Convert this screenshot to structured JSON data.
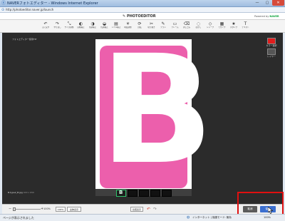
{
  "window": {
    "title": "NAVERフォトエディター - Windows Internet Explorer",
    "address": "http://photoeditor.naver.jp/launch",
    "min_icon": "minimize-icon",
    "max_icon": "maximize-icon",
    "close_icon": "close-icon"
  },
  "app": {
    "logo": "PHOTOEDITOR",
    "powered_by": "Powered by",
    "brand": "NAVER"
  },
  "toolbar": {
    "tools": [
      {
        "label": "元に戻す",
        "icon": "↶"
      },
      {
        "label": "やり直し",
        "icon": "↷"
      },
      {
        "label": "サイズ調整",
        "icon": "⤡"
      },
      {
        "label": "自動補正",
        "icon": "◐"
      },
      {
        "label": "色調補正",
        "icon": "◑"
      },
      {
        "label": "色調補正",
        "icon": "◒"
      },
      {
        "label": "レベル補正",
        "icon": "▤"
      },
      {
        "label": "明度調整",
        "icon": "☀"
      },
      {
        "label": "回転",
        "icon": "⟳"
      },
      {
        "label": "切り抜き",
        "icon": "✂"
      },
      {
        "label": "ブラシ",
        "icon": "✎"
      },
      {
        "label": "フレーム",
        "icon": "▭"
      },
      {
        "label": "消しゴム",
        "icon": "⌫"
      },
      {
        "label": "ぼかし",
        "icon": "◌"
      },
      {
        "label": "シャープ",
        "icon": "◇"
      },
      {
        "label": "モザイク",
        "icon": "▦"
      },
      {
        "label": "スタンプ",
        "icon": "★"
      },
      {
        "label": "テキスト",
        "icon": "T"
      }
    ]
  },
  "editor": {
    "breadcrumb": "フォトエディター使用TIP",
    "color_label": "カラー選択",
    "layer_label": "レイヤー",
    "accent_color": "#e11d1d",
    "image_letter": "B",
    "image_color": "#ec5fac",
    "filename": "B.type2_B.jpg",
    "filename_size": "400 x 650",
    "thumb_letter": "B"
  },
  "bottom": {
    "zoom_minus": "−",
    "zoom_plus": "+",
    "zoom_value": "100%",
    "btn_actual": "100%",
    "btn_fit": "全体表示",
    "btn_compare": "比較表示",
    "cancel": "取消",
    "save": "保存"
  },
  "status": {
    "text": "ページが表示されました",
    "zone": "インターネット | 保護モード: 無効",
    "zoom": "100%"
  }
}
